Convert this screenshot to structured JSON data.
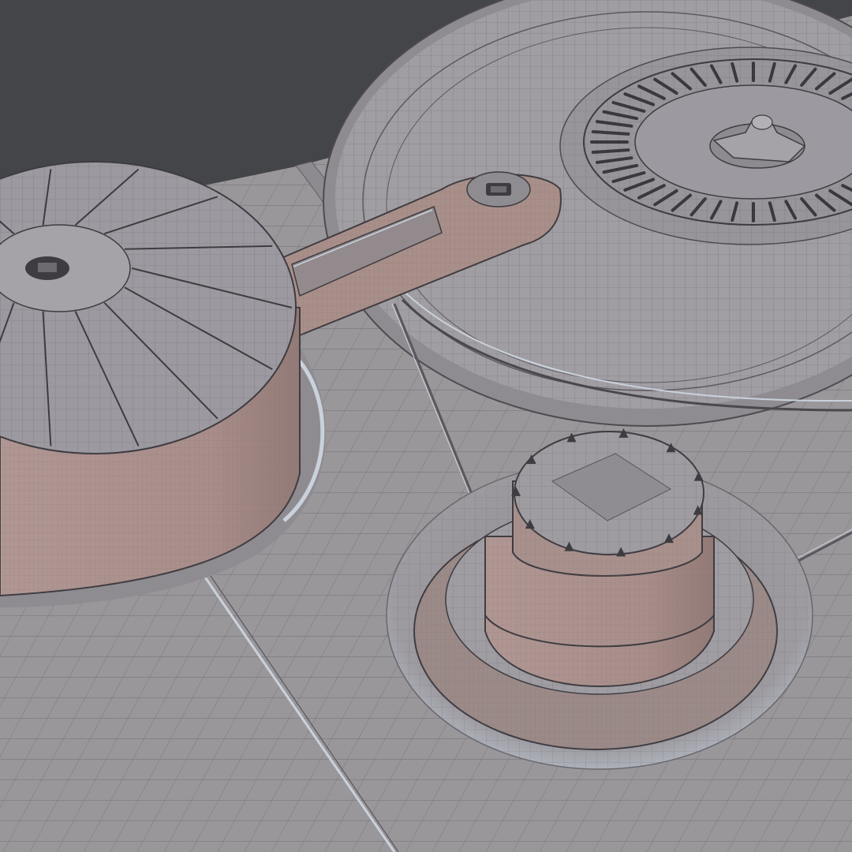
{
  "viewport": {
    "background_color": "#444548"
  },
  "scene": {
    "subject": "wireframe-render-of-mechanical-deck",
    "colors": {
      "plate": "#9a979b",
      "plate_light": "#a8a6aa",
      "metal_side": "#a98f8a",
      "metal_side_dark": "#8c7571",
      "wire": "#5f5c62",
      "edge_dark": "#3e3c41",
      "highlight": "#c9d2dc"
    },
    "objects": [
      {
        "name": "platter"
      },
      {
        "name": "spindle-hub"
      },
      {
        "name": "left-drum"
      },
      {
        "name": "connecting-arm"
      },
      {
        "name": "right-knob"
      },
      {
        "name": "guide-wire"
      }
    ]
  }
}
